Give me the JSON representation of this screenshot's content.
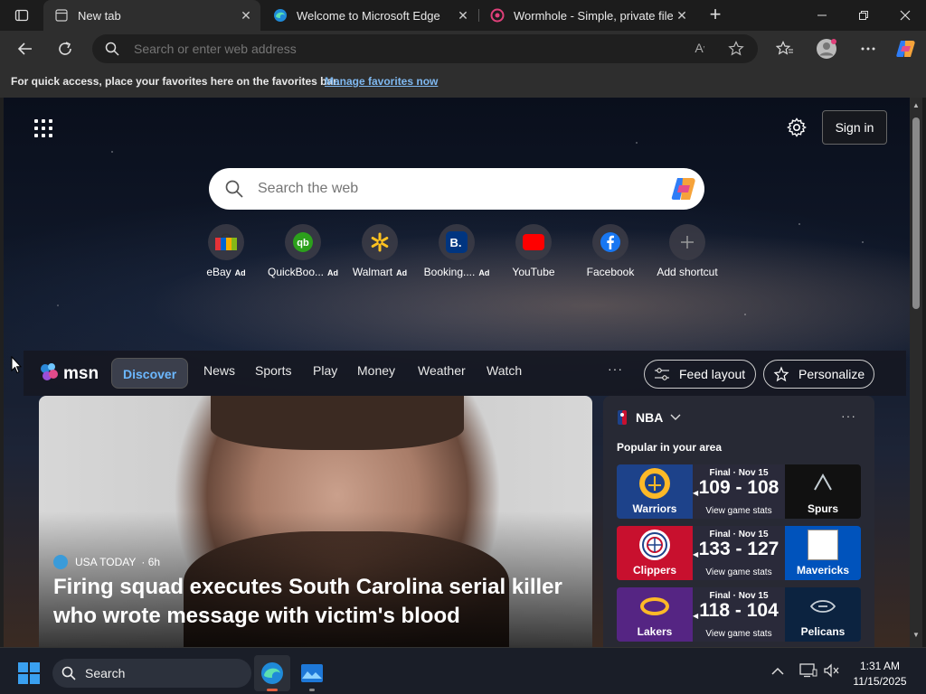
{
  "browser": {
    "tabs": [
      {
        "title": "New tab",
        "icon": "new-tab-icon"
      },
      {
        "title": "Welcome to Microsoft Edge",
        "icon": "edge-icon"
      },
      {
        "title": "Wormhole - Simple, private file sh",
        "icon": "wormhole-icon"
      }
    ],
    "address_placeholder": "Search or enter web address",
    "favorites_message": "For quick access, place your favorites here on the favorites bar.",
    "favorites_link": "Manage favorites now"
  },
  "newtab": {
    "sign_in_label": "Sign in",
    "search_placeholder": "Search the web",
    "shortcuts": [
      {
        "label": "eBay",
        "ad": "Ad",
        "icon": "ebay-icon"
      },
      {
        "label": "QuickBoo...",
        "ad": "Ad",
        "icon": "quickbooks-icon"
      },
      {
        "label": "Walmart",
        "ad": "Ad",
        "icon": "walmart-icon"
      },
      {
        "label": "Booking....",
        "ad": "Ad",
        "icon": "booking-icon"
      },
      {
        "label": "YouTube",
        "ad": "",
        "icon": "youtube-icon"
      },
      {
        "label": "Facebook",
        "ad": "",
        "icon": "facebook-icon"
      },
      {
        "label": "Add shortcut",
        "ad": "",
        "icon": "add-icon"
      }
    ]
  },
  "msn": {
    "logo_text": "msn",
    "tabs": [
      "Discover",
      "News",
      "Sports",
      "Play",
      "Money",
      "Weather",
      "Watch"
    ],
    "active_tab": "Discover",
    "more_label": "···",
    "feed_layout_label": "Feed layout",
    "personalize_label": "Personalize"
  },
  "hero": {
    "source": "USA TODAY",
    "time": "· 6h",
    "headline": "Firing squad executes South Carolina serial killer who wrote message with victim's blood"
  },
  "nba": {
    "title": "NBA",
    "subtitle": "Popular in your area",
    "games": [
      {
        "status": "Final · Nov 15",
        "score": "109 - 108",
        "link": "View game stats",
        "home": "Warriors",
        "away": "Spurs",
        "home_color": "#1d428a",
        "away_color": "#1a1a1a"
      },
      {
        "status": "Final · Nov 15",
        "score": "133 - 127",
        "link": "View game stats",
        "home": "Clippers",
        "away": "Mavericks",
        "home_color": "#c8102e",
        "away_color": "#0053bc"
      },
      {
        "status": "Final · Nov 15",
        "score": "118 - 104",
        "link": "View game stats",
        "home": "Lakers",
        "away": "Pelicans",
        "home_color": "#552583",
        "away_color": "#0c2340"
      }
    ]
  },
  "taskbar": {
    "search_label": "Search",
    "time": "1:31 AM",
    "date": "11/15/2025"
  }
}
